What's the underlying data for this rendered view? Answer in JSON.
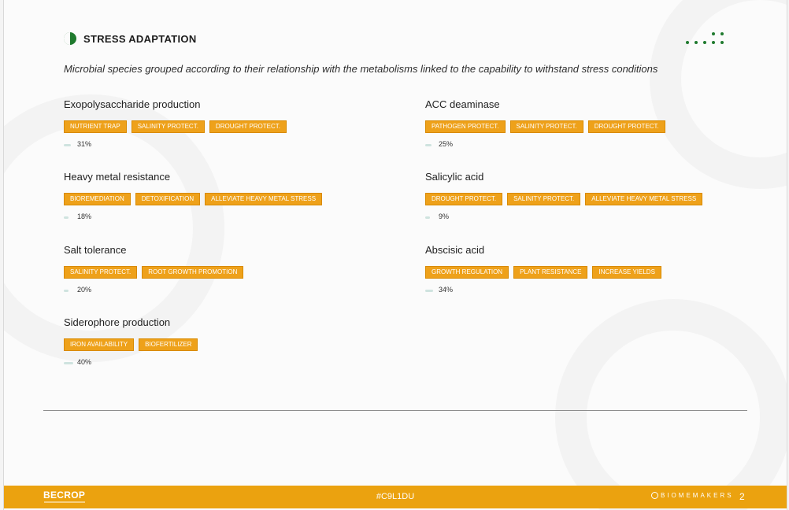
{
  "header": {
    "title": "STRESS ADAPTATION",
    "subtitle": "Microbial species grouped according to their relationship with the metabolisms linked to the capability to withstand stress conditions"
  },
  "colors": {
    "accent_green": "#1f7a2e",
    "tag_orange": "#eea11a",
    "footer_orange": "#eba20f",
    "percent_bar": "#cfe3df"
  },
  "groups": [
    {
      "title": "Exopolysaccharide production",
      "tags": [
        "NUTRIENT TRAP",
        "SALINITY PROTECT.",
        "DROUGHT PROTECT."
      ],
      "percent": "31%",
      "value": 31
    },
    {
      "title": "ACC deaminase",
      "tags": [
        "PATHOGEN PROTECT.",
        "SALINITY PROTECT.",
        "DROUGHT PROTECT."
      ],
      "percent": "25%",
      "value": 25
    },
    {
      "title": "Heavy metal resistance",
      "tags": [
        "BIOREMEDIATION",
        "DETOXIFICATION",
        "ALLEVIATE HEAVY METAL STRESS"
      ],
      "percent": "18%",
      "value": 18
    },
    {
      "title": "Salicylic acid",
      "tags": [
        "DROUGHT PROTECT.",
        "SALINITY PROTECT.",
        "ALLEVIATE HEAVY METAL STRESS"
      ],
      "percent": "9%",
      "value": 9
    },
    {
      "title": "Salt tolerance",
      "tags": [
        "SALINITY PROTECT.",
        "ROOT GROWTH PROMOTION"
      ],
      "percent": "20%",
      "value": 20
    },
    {
      "title": "Abscisic acid",
      "tags": [
        "GROWTH REGULATION",
        "PLANT RESISTANCE",
        "INCREASE YIELDS"
      ],
      "percent": "34%",
      "value": 34
    },
    {
      "title": "Siderophore production",
      "tags": [
        "IRON AVAILABILITY",
        "BIOFERTILIZER"
      ],
      "percent": "40%",
      "value": 40
    }
  ],
  "footer": {
    "logo": "BECROP",
    "code": "#C9L1DU",
    "brand": "BIOMEMAKERS",
    "page_number": "2"
  }
}
